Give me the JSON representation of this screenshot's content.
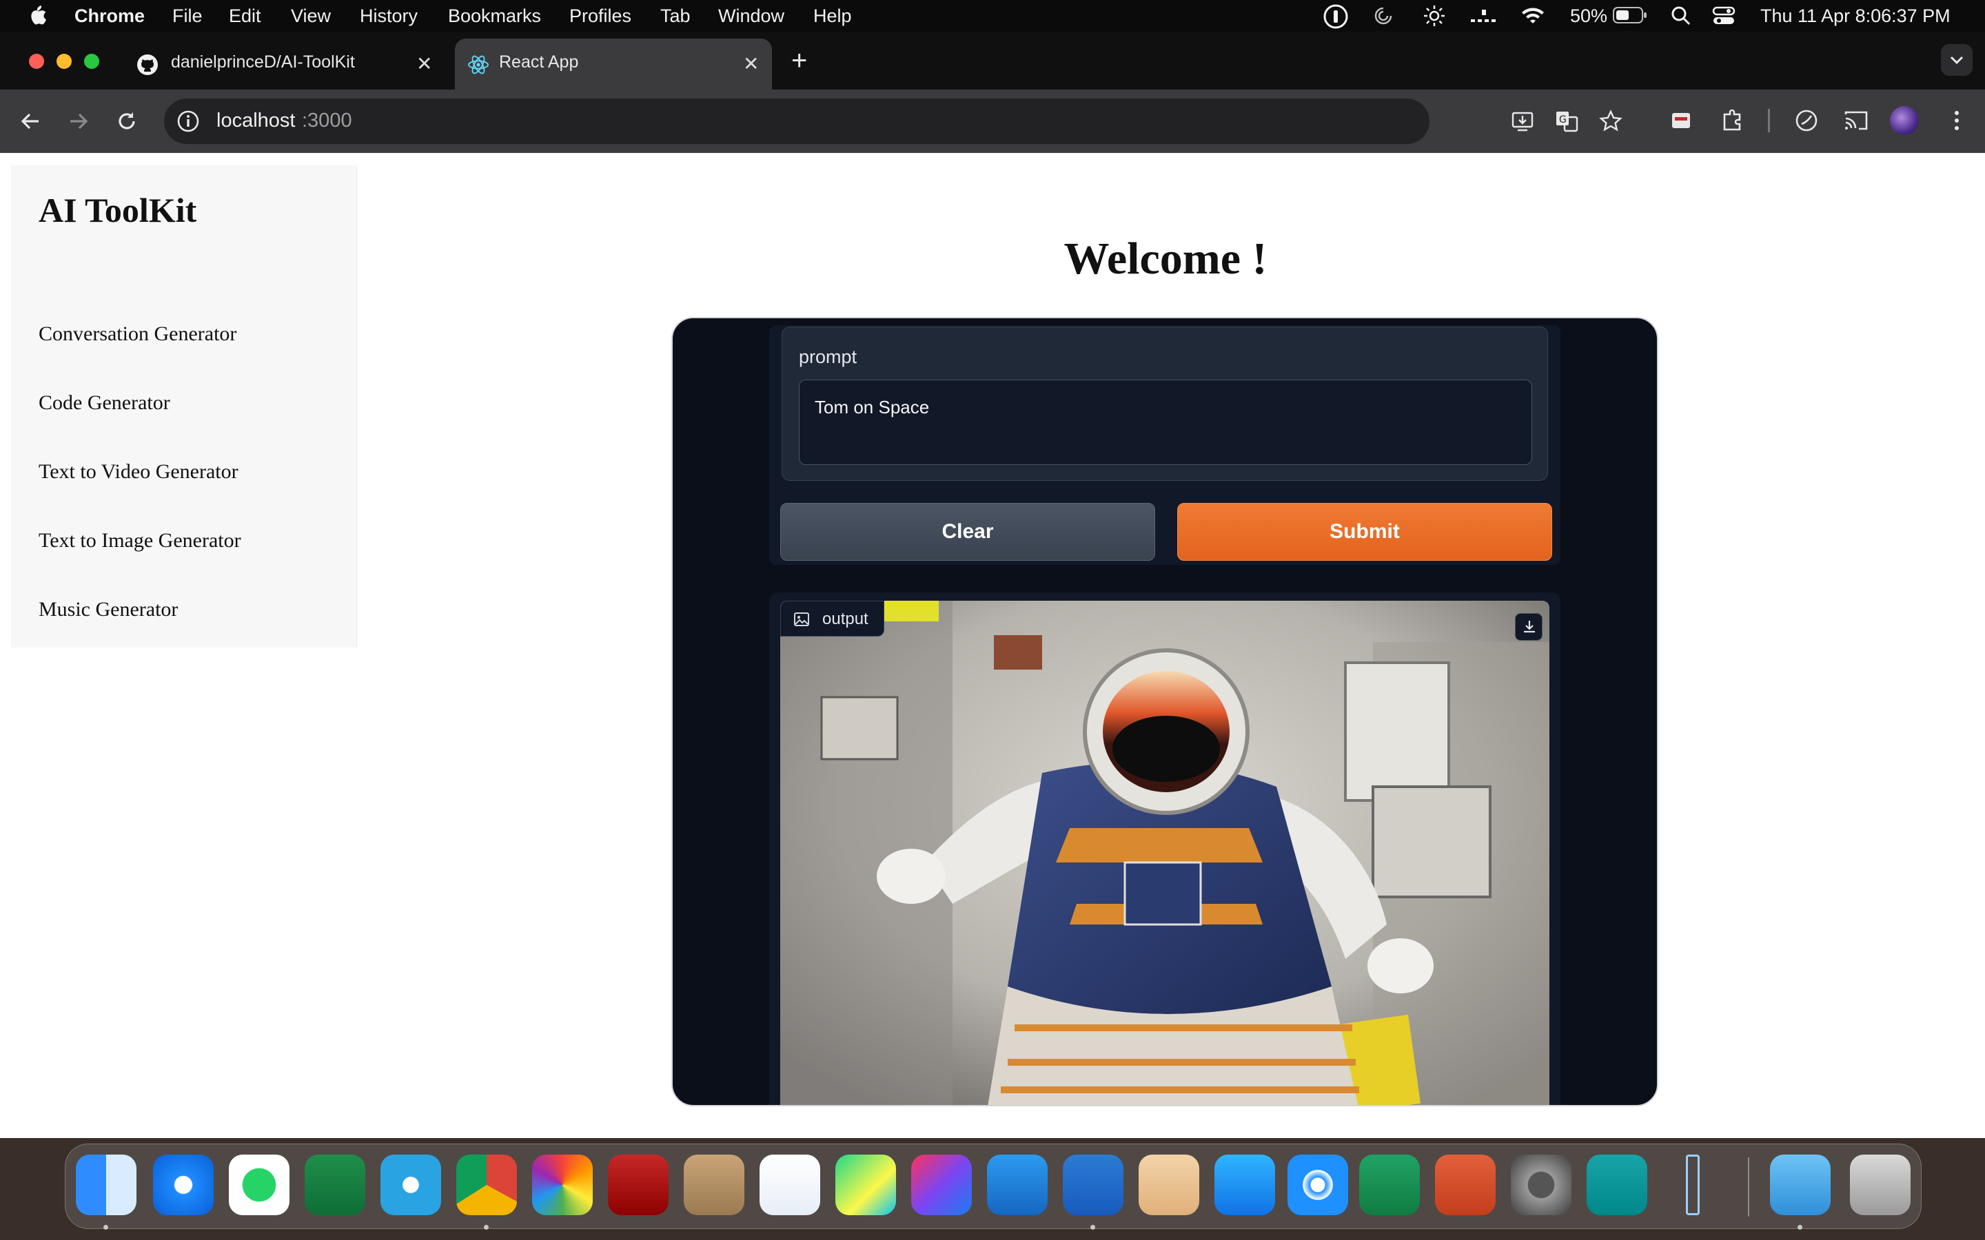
{
  "menubar": {
    "app_name": "Chrome",
    "items": [
      "File",
      "Edit",
      "View",
      "History",
      "Bookmarks",
      "Profiles",
      "Tab",
      "Window",
      "Help"
    ],
    "battery": "50%",
    "datetime": "Thu 11 Apr  8:06:37 PM"
  },
  "browser": {
    "tabs": [
      {
        "title": "danielprinceD/AI-ToolKit",
        "icon": "github-icon",
        "active": false
      },
      {
        "title": "React App",
        "icon": "react-icon",
        "active": true
      }
    ],
    "url_host": "localhost",
    "url_port": ":3000"
  },
  "sidebar": {
    "brand": "AI ToolKit",
    "items": [
      {
        "label": "Conversation Generator"
      },
      {
        "label": "Code Generator"
      },
      {
        "label": "Text to Video Generator"
      },
      {
        "label": "Text to Image Generator"
      },
      {
        "label": "Music Generator"
      }
    ]
  },
  "main": {
    "heading": "Welcome !",
    "prompt_label": "prompt",
    "prompt_value": "Tom on Space",
    "clear_label": "Clear",
    "submit_label": "Submit",
    "output_label": "output"
  },
  "colors": {
    "submit": "#e8692a",
    "clear": "#434b58",
    "gradio_bg": "#0b0f19",
    "panel": "#111827"
  },
  "dock": {
    "apps": [
      "Finder",
      "Safari",
      "WhatsApp",
      "Google Classroom",
      "Telegram",
      "Chrome",
      "Photos",
      "Photo Booth",
      "Contacts",
      "Instruments",
      "PyCharm",
      "IntelliJ IDEA",
      "Visual Studio Code",
      "Microsoft Word",
      "Archive Utility",
      "App Store",
      "AirDrop",
      "Microsoft Excel",
      "Microsoft PowerPoint",
      "System Settings",
      "Arduino",
      "Audio Meter",
      "Downloads",
      "Trash"
    ]
  }
}
